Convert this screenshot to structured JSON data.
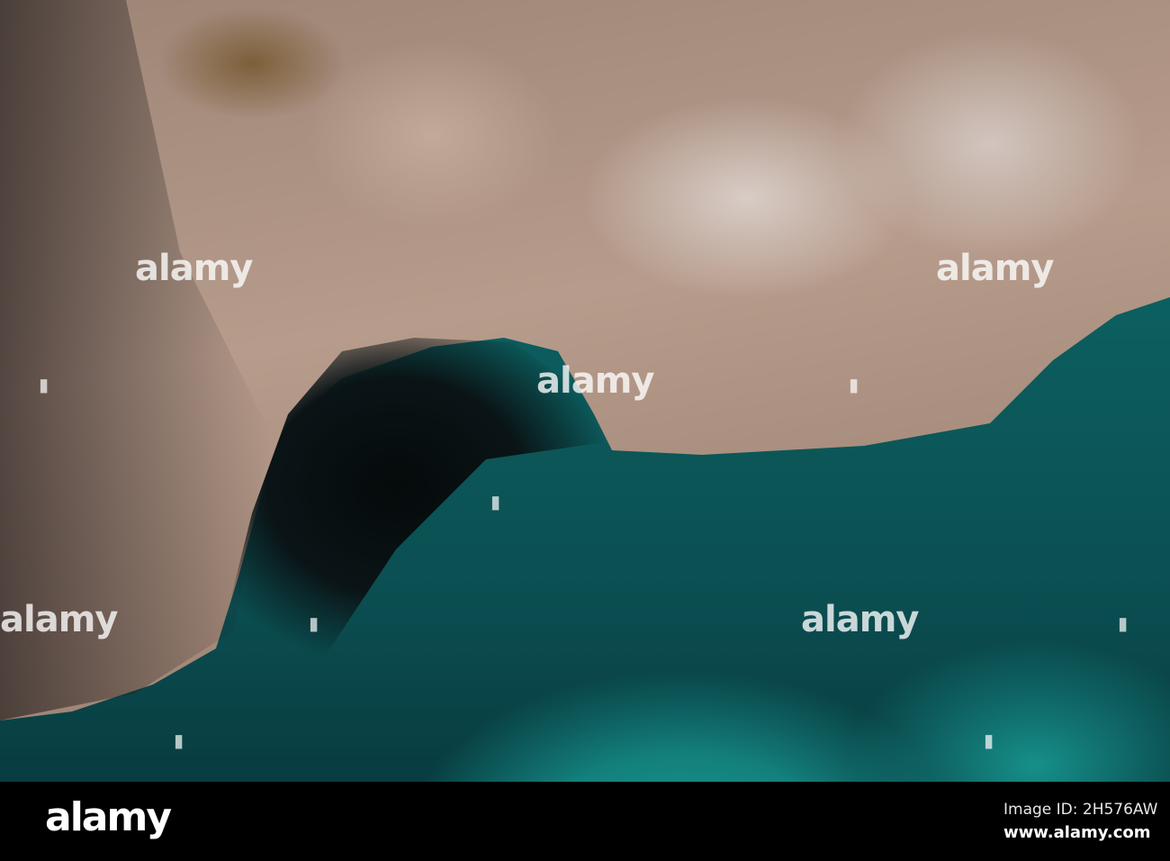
{
  "watermark": {
    "text": "alamy"
  },
  "footer": {
    "logo": "alamy",
    "image_id": "Image ID: 2H576AW",
    "website": "www.alamy.com"
  }
}
